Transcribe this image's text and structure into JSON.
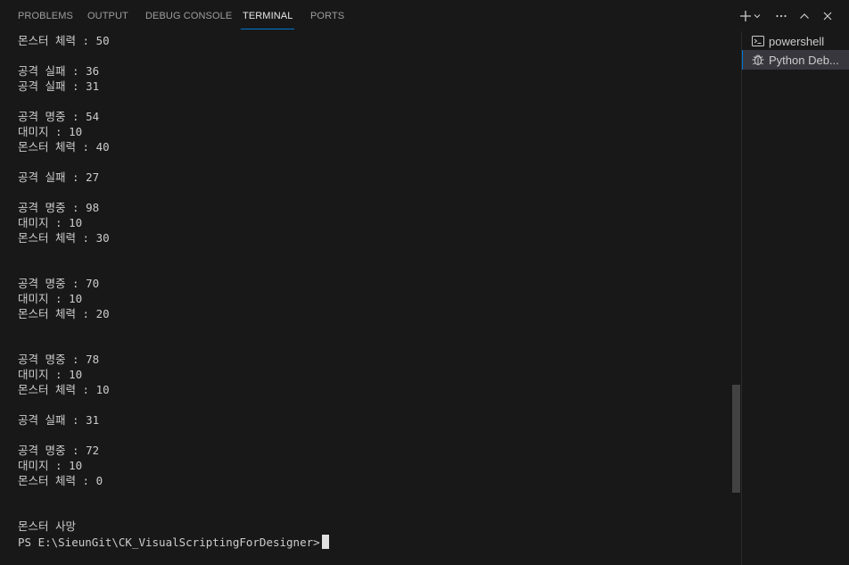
{
  "tabs": [
    {
      "label": "PROBLEMS"
    },
    {
      "label": "OUTPUT"
    },
    {
      "label": "DEBUG CONSOLE"
    },
    {
      "label": "TERMINAL",
      "active": true
    },
    {
      "label": "PORTS"
    }
  ],
  "actions": {
    "new_terminal_icon": "plus-icon",
    "dropdown_icon": "chevron-down-icon",
    "more_icon": "ellipsis-icon",
    "maximize_icon": "chevron-up-icon",
    "close_icon": "close-icon"
  },
  "terminal": {
    "lines": [
      "몬스터 체력 : 50",
      "",
      "공격 실패 : 36",
      "공격 실패 : 31",
      "",
      "공격 명중 : 54",
      "대미지 : 10",
      "몬스터 체력 : 40",
      "",
      "공격 실패 : 27",
      "",
      "공격 명중 : 98",
      "대미지 : 10",
      "몬스터 체력 : 30",
      "",
      "",
      "공격 명중 : 70",
      "대미지 : 10",
      "몬스터 체력 : 20",
      "",
      "",
      "공격 명중 : 78",
      "대미지 : 10",
      "몬스터 체력 : 10",
      "",
      "공격 실패 : 31",
      "",
      "공격 명중 : 72",
      "대미지 : 10",
      "몬스터 체력 : 0",
      "",
      "",
      "몬스터 사망"
    ],
    "prompt": "PS E:\\SieunGit\\CK_VisualScriptingForDesigner>"
  },
  "terminal_list": [
    {
      "label": "powershell",
      "icon": "terminal-icon"
    },
    {
      "label": "Python Deb...",
      "icon": "debug-icon",
      "selected": true
    }
  ],
  "colors": {
    "background": "#181818",
    "text": "#cccccc",
    "accent": "#0078d4"
  }
}
